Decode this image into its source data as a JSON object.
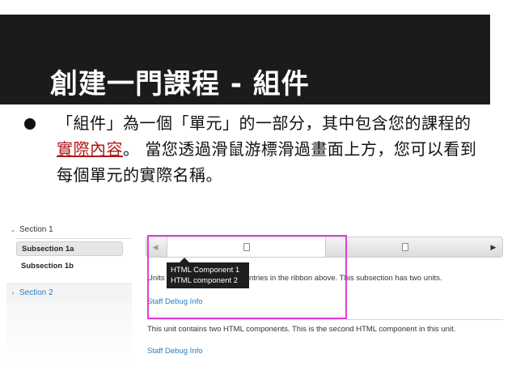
{
  "slide": {
    "title": "創建一門課程 - 組件",
    "bullet_part1": "「組件」為一個「單元」的一部分，其中包含您的課程的",
    "bullet_link": "實際內容",
    "bullet_part2": "。 當您透過滑鼠游標滑過畫面上方，您可以看到每個單元的實際名稱。"
  },
  "screenshot": {
    "sidebar": {
      "section1": "Section 1",
      "subsection_a": "Subsection 1a",
      "subsection_b": "Subsection 1b",
      "section2": "Section 2"
    },
    "tooltip": {
      "line1": "HTML Component 1",
      "line2": "HTML component 2"
    },
    "content": {
      "line1_left": "Units",
      "line1_right": "ntries in the ribbon above. This subsection has two units.",
      "debug_link1": "Staff Debug Info",
      "line2": "This unit contains two HTML components. This is the second HTML component in this unit.",
      "debug_link2": "Staff Debug Info"
    }
  }
}
